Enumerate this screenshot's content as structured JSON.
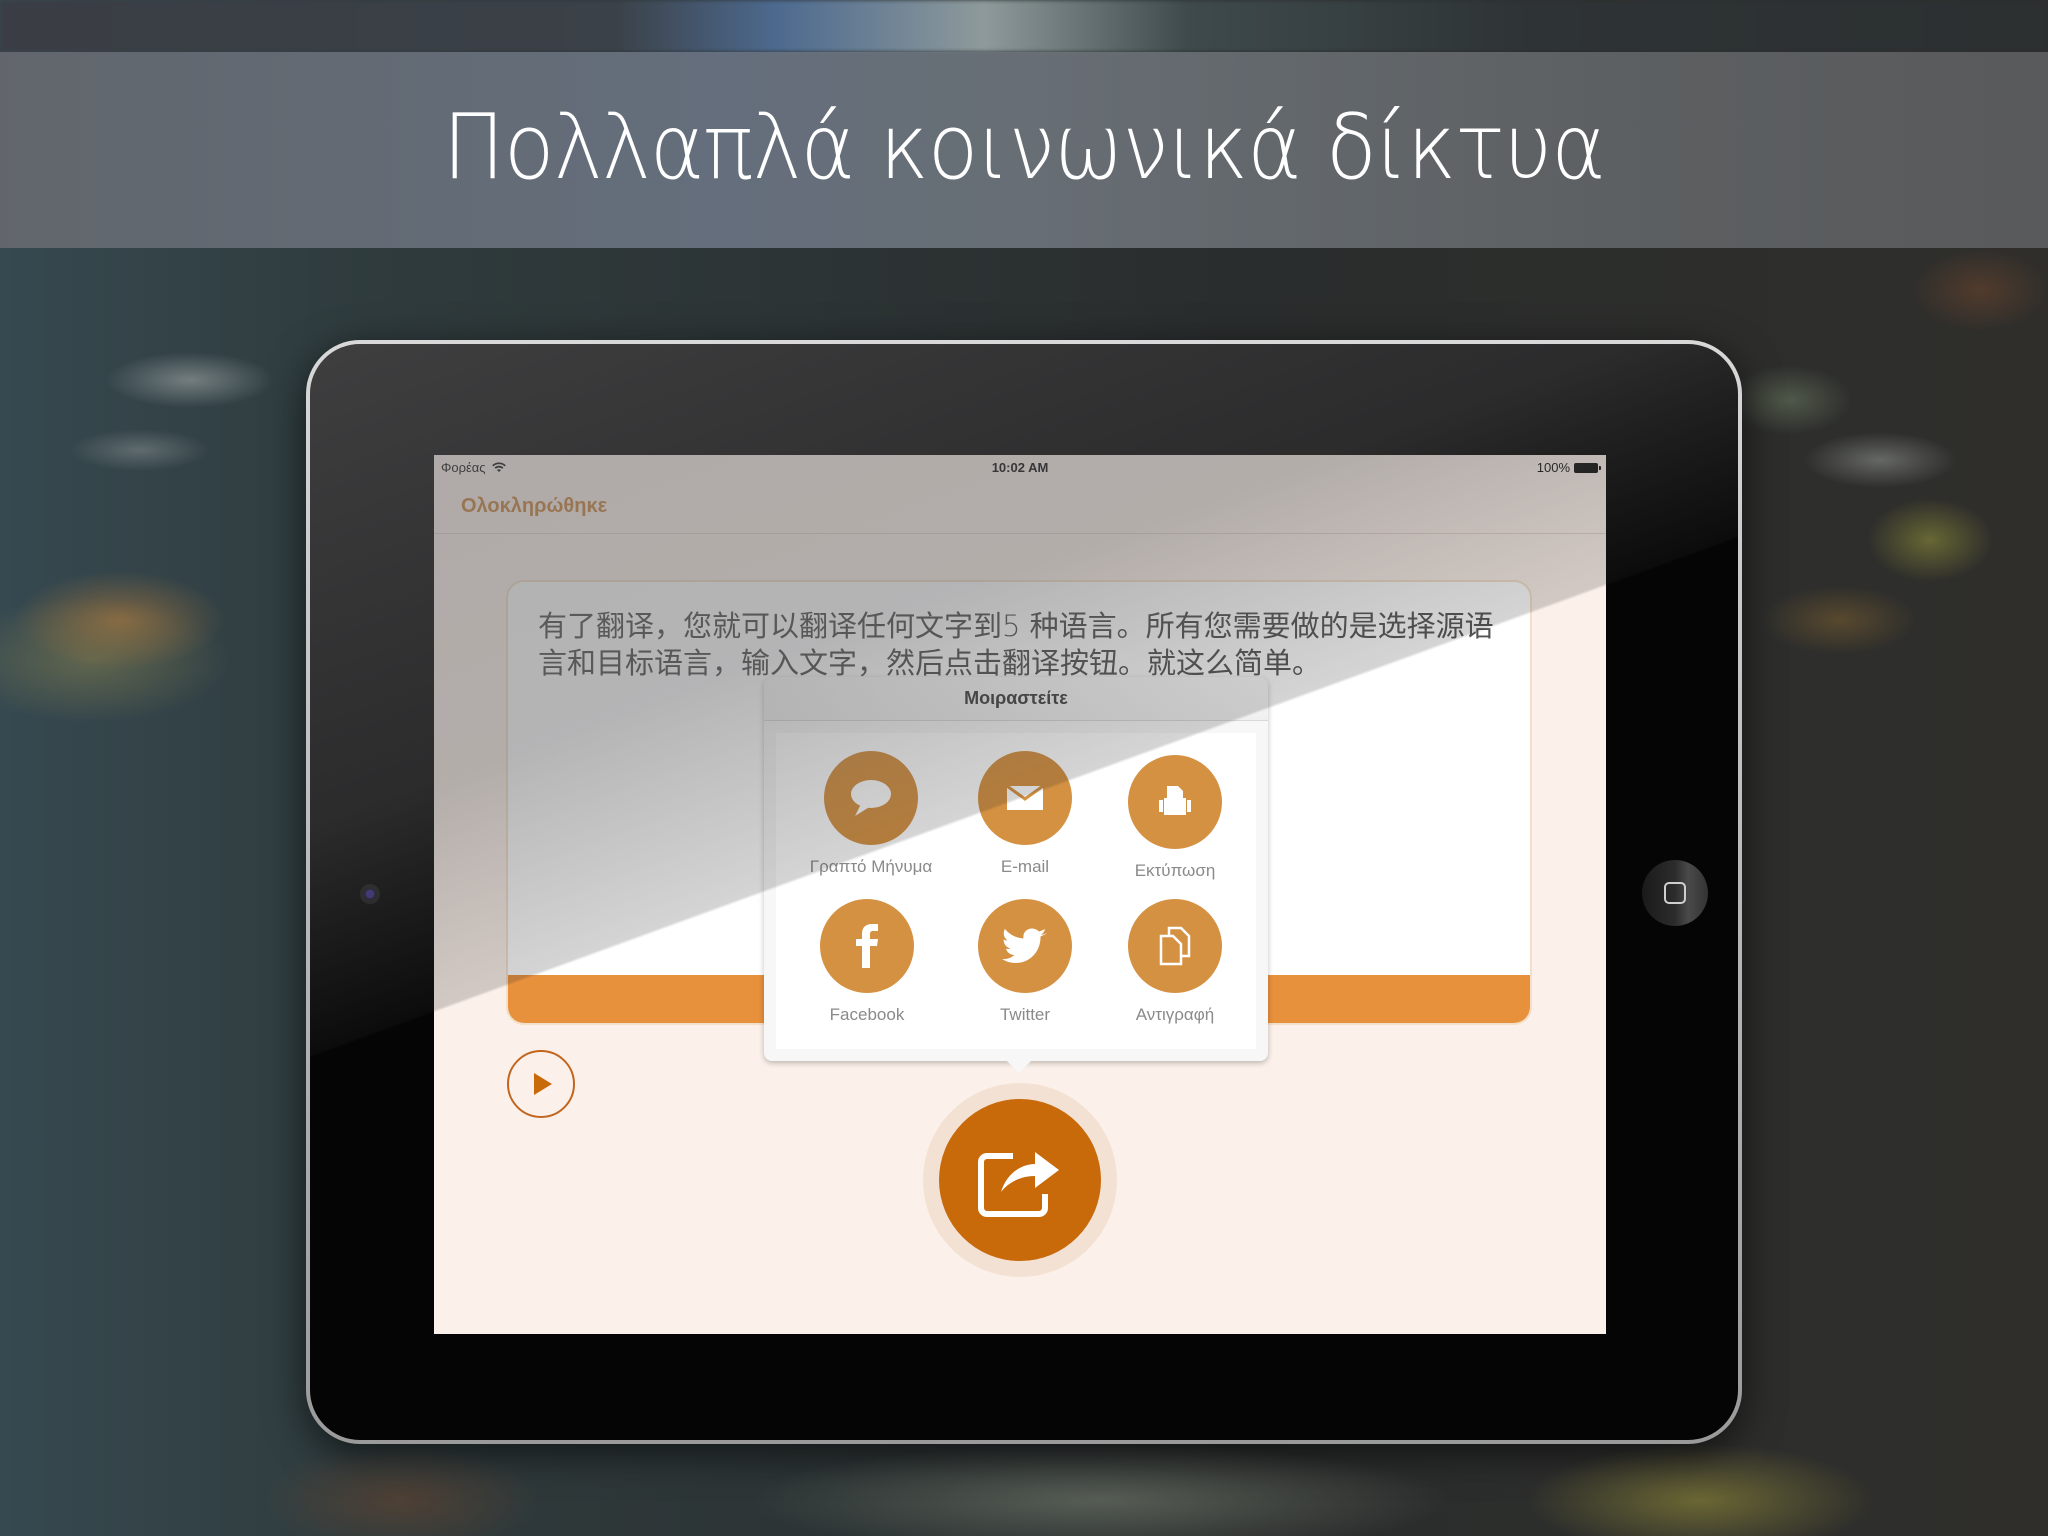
{
  "promo": {
    "headline": "Πολλαπλά κοινωνικά δίκτυα"
  },
  "status_bar": {
    "carrier": "Φορέας",
    "wifi_icon": "wifi-icon",
    "time": "10:02 AM",
    "battery_percent": "100%",
    "battery_icon": "battery-icon"
  },
  "nav": {
    "done_label": "Ολοκληρώθηκε"
  },
  "translation": {
    "text": "有了翻译，您就可以翻译任何文字到5 种语言。所有您需要做的是选择源语言和目标语言，输入文字，然后点击翻译按钮。就这么简单。"
  },
  "controls": {
    "play_icon": "play-icon",
    "share_icon": "share-icon"
  },
  "share_popover": {
    "title": "Μοιραστείτε",
    "items": [
      {
        "label": "Γραπτό Μήνυμα",
        "icon": "message-icon"
      },
      {
        "label": "E-mail",
        "icon": "mail-icon"
      },
      {
        "label": "Εκτύπωση",
        "icon": "printer-icon"
      },
      {
        "label": "Facebook",
        "icon": "facebook-icon"
      },
      {
        "label": "Twitter",
        "icon": "twitter-icon"
      },
      {
        "label": "Αντιγραφή",
        "icon": "copy-icon"
      }
    ]
  },
  "colors": {
    "accent": "#cc8640",
    "share_icon_bg": "#d59142",
    "share_button_bg": "#c8690a",
    "card_bar": "#e8913d",
    "screen_bg": "#fcf1ea"
  }
}
